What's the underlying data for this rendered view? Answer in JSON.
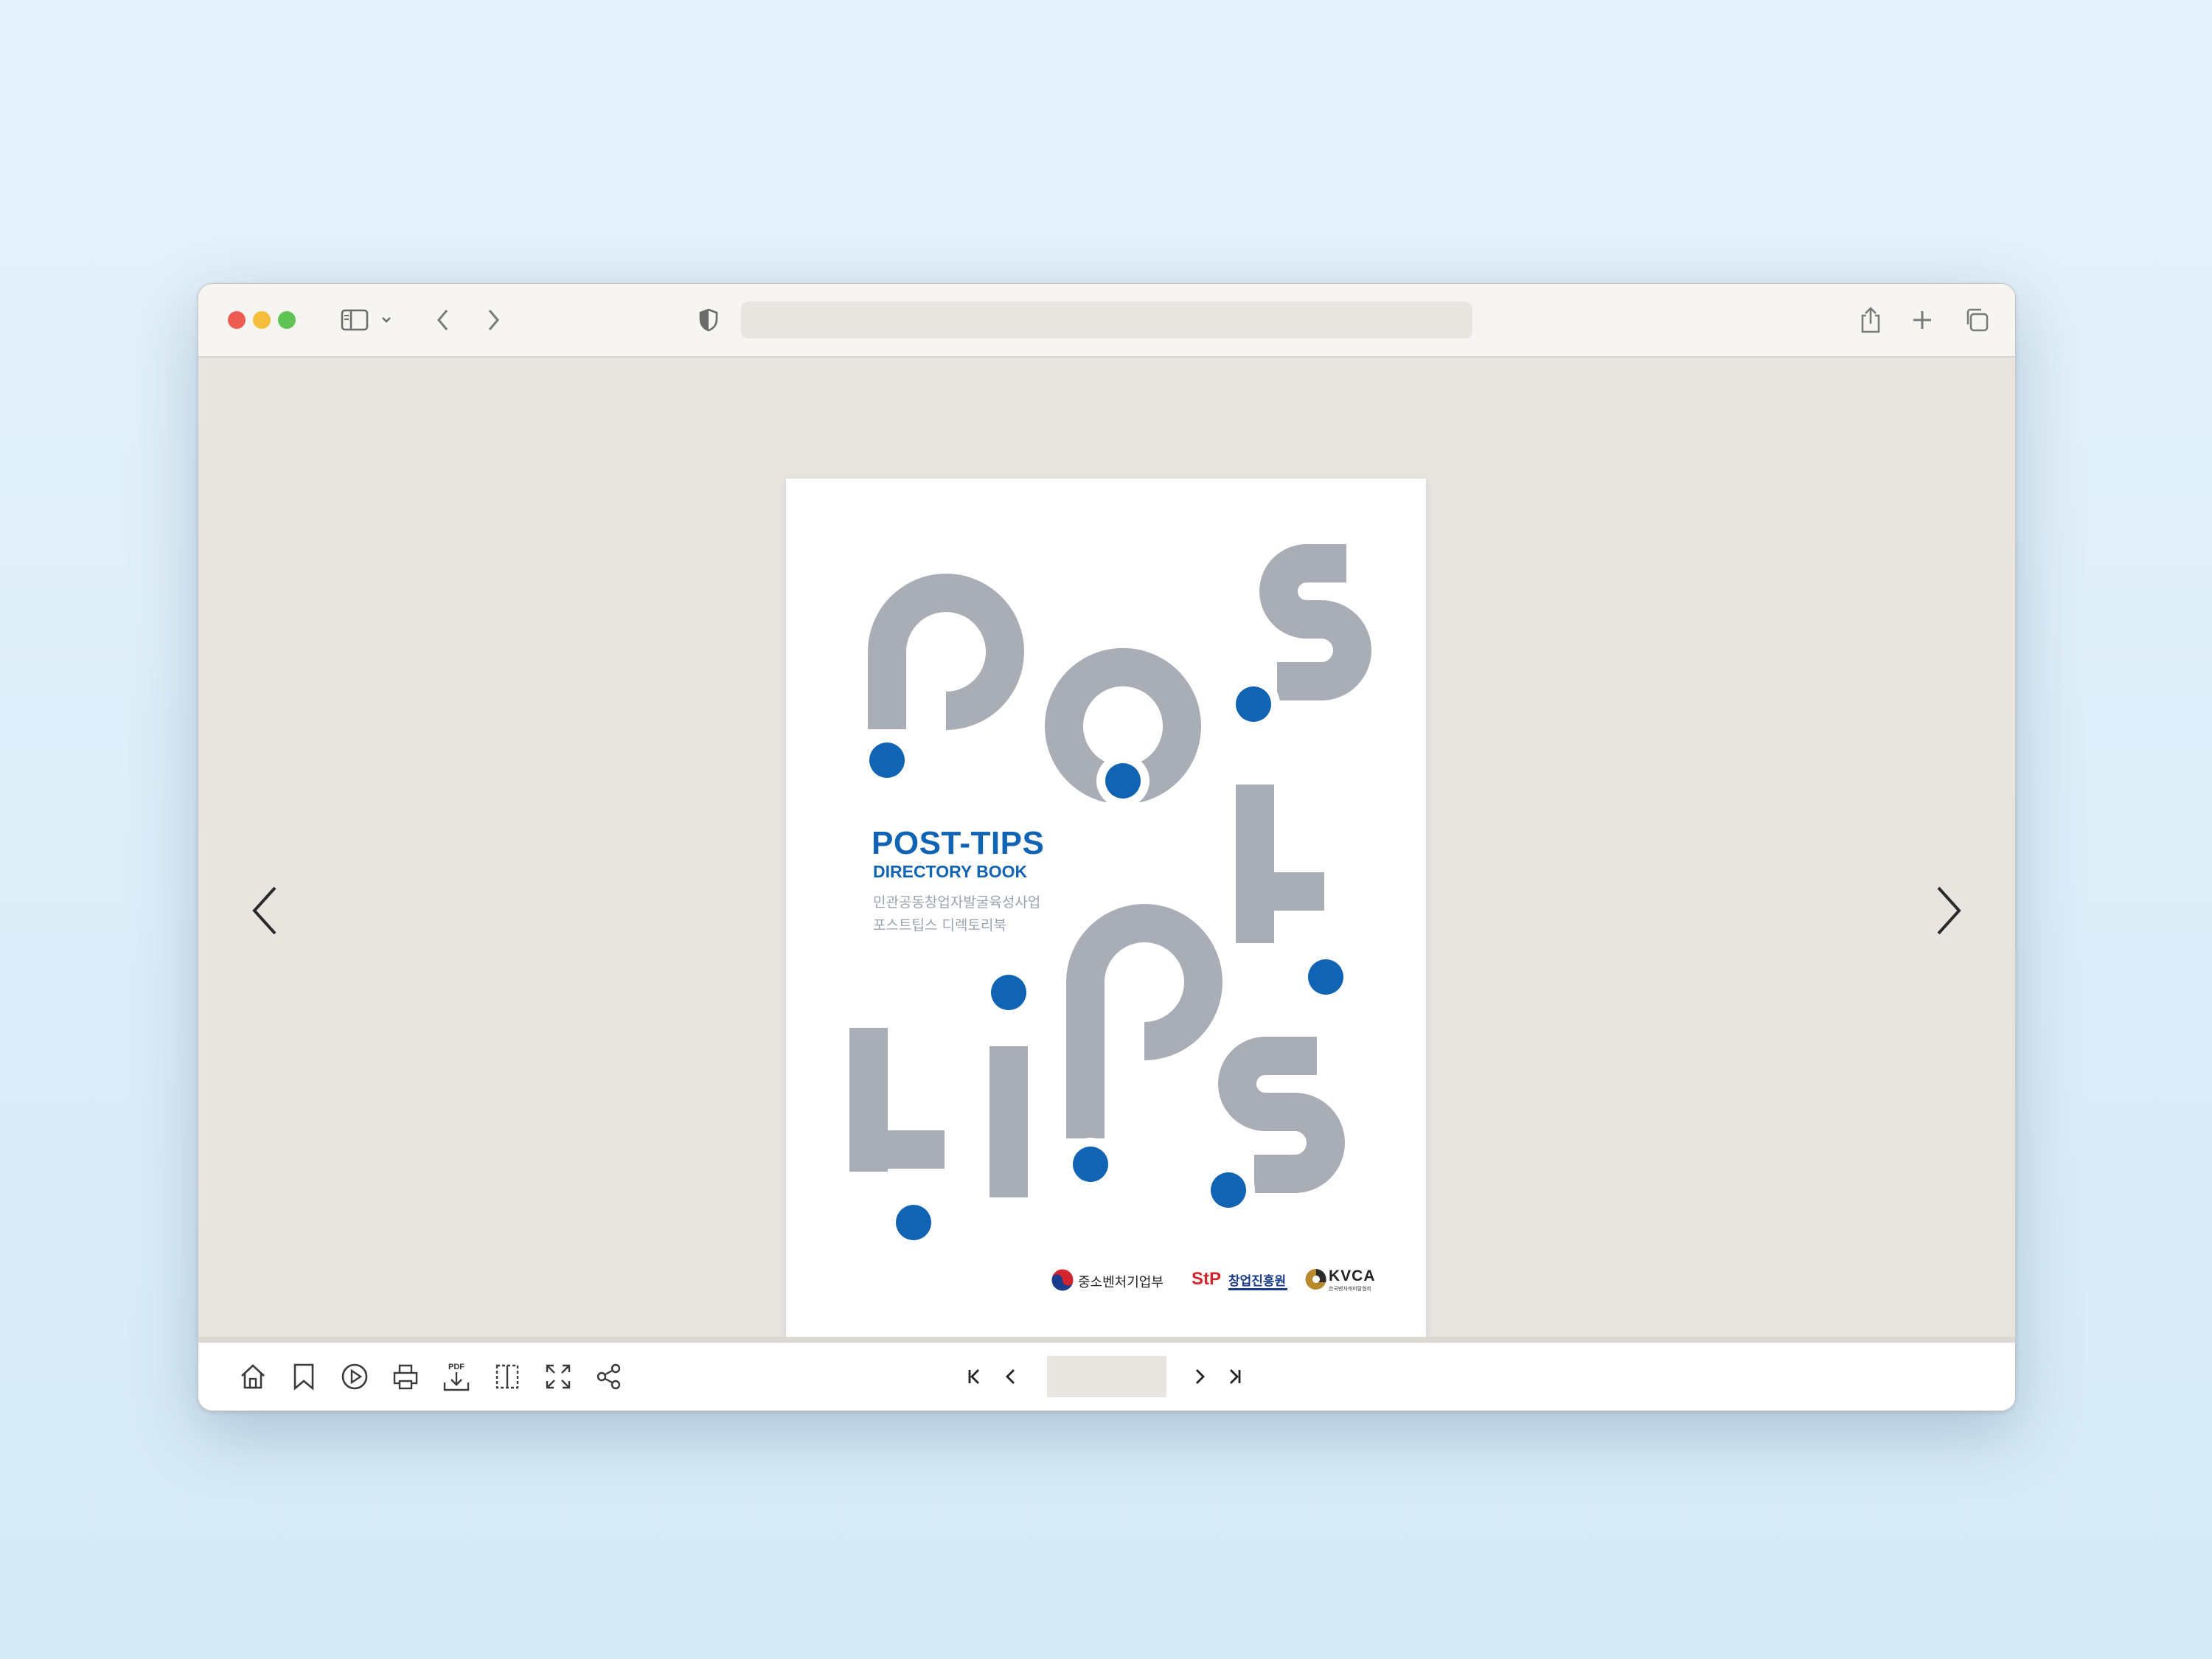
{
  "browser": {
    "address_text": "",
    "icons": [
      "sidebar-icon",
      "chevron-down-icon",
      "back-icon",
      "forward-icon",
      "shield-icon",
      "share-icon",
      "new-tab-icon",
      "tabs-icon"
    ]
  },
  "document": {
    "cover": {
      "title": "POST-TIPS",
      "subtitle": "DIRECTORY BOOK",
      "korean_line1": "민관공동창업자발굴육성사업",
      "korean_line2": "포스트팁스 디렉토리북",
      "logos": {
        "ministry": "중소벤처기업부",
        "kised": "창업진흥원",
        "kised_mark": "StP",
        "kvca": "KVCA",
        "kvca_sub": "한국벤처캐피탈협회"
      },
      "colors": {
        "accent_blue": "#1164b4",
        "letter_gray": "#a9aeb6"
      }
    }
  },
  "viewer": {
    "bottom_toolbar": {
      "pdf_label": "PDF",
      "page_value": "",
      "icons": [
        "home-icon",
        "bookmark-icon",
        "play-icon",
        "print-icon",
        "pdf-download-icon",
        "single-page-icon",
        "fullscreen-icon",
        "share-nodes-icon",
        "first-page-icon",
        "prev-page-icon",
        "next-page-icon",
        "last-page-icon"
      ]
    }
  }
}
